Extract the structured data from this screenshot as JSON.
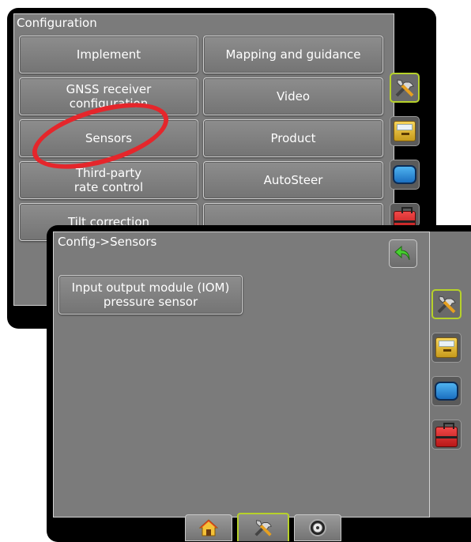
{
  "back_screen": {
    "title": "Configuration",
    "buttons": [
      {
        "id": "implement",
        "label": "Implement"
      },
      {
        "id": "mapping",
        "label": "Mapping and guidance"
      },
      {
        "id": "gnss",
        "label": "GNSS receiver\nconfiguration"
      },
      {
        "id": "video",
        "label": "Video"
      },
      {
        "id": "sensors",
        "label": "Sensors"
      },
      {
        "id": "product",
        "label": "Product"
      },
      {
        "id": "third_party",
        "label": "Third-party\nrate control"
      },
      {
        "id": "autosteer",
        "label": "AutoSteer"
      },
      {
        "id": "tilt",
        "label": "Tilt correction"
      }
    ]
  },
  "front_screen": {
    "title": "Config->Sensors",
    "iom_button": "Input output module (IOM)\npressure sensor"
  },
  "side_tabs": [
    "configuration-tools-icon",
    "job-folder-icon",
    "display-screen-icon",
    "toolbox-icon"
  ],
  "bottom_tabs": [
    "home-icon",
    "configuration-tools-icon",
    "guidance-wheel-icon"
  ],
  "colors": {
    "active_outline": "#b6d12a",
    "highlight": "#e5262b",
    "panel": "#7b7b7b"
  }
}
